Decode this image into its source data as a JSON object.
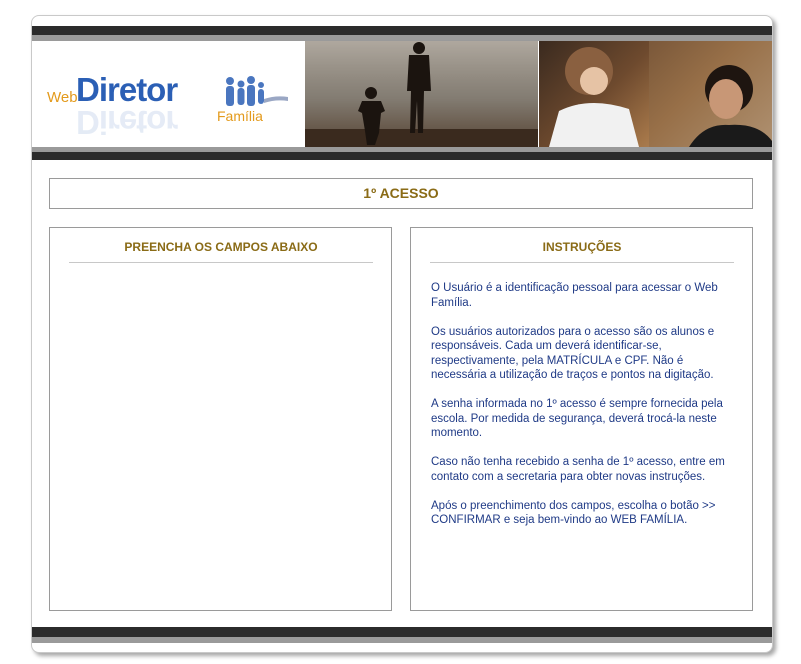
{
  "logo": {
    "web": "Web",
    "diretor": "Diretor",
    "familia": "Família"
  },
  "title": "1º ACESSO",
  "left_panel": {
    "heading": "PREENCHA OS CAMPOS ABAIXO"
  },
  "right_panel": {
    "heading": "INSTRUÇÕES",
    "paragraphs": [
      "O Usuário é a identificação pessoal para acessar o Web Família.",
      "Os usuários autorizados para o acesso são os alunos e responsáveis. Cada um deverá identificar-se, respectivamente, pela MATRÍCULA e CPF. Não é necessária a utilização de traços e pontos na digitação.",
      "A senha informada no 1º acesso é sempre fornecida pela escola. Por medida de segurança, deverá trocá-la neste momento.",
      "Caso não tenha recebido a senha de 1º acesso, entre em contato com a secretaria para obter novas instruções.",
      "Após o preenchimento dos campos, escolha o botão >> CONFIRMAR e seja bem-vindo ao WEB FAMÍLIA."
    ]
  },
  "colors": {
    "heading": "#8a6b16",
    "instruction_text": "#1f3a86",
    "stripe_dark": "#2b2b2b",
    "stripe_grey": "#9a9a9a"
  }
}
